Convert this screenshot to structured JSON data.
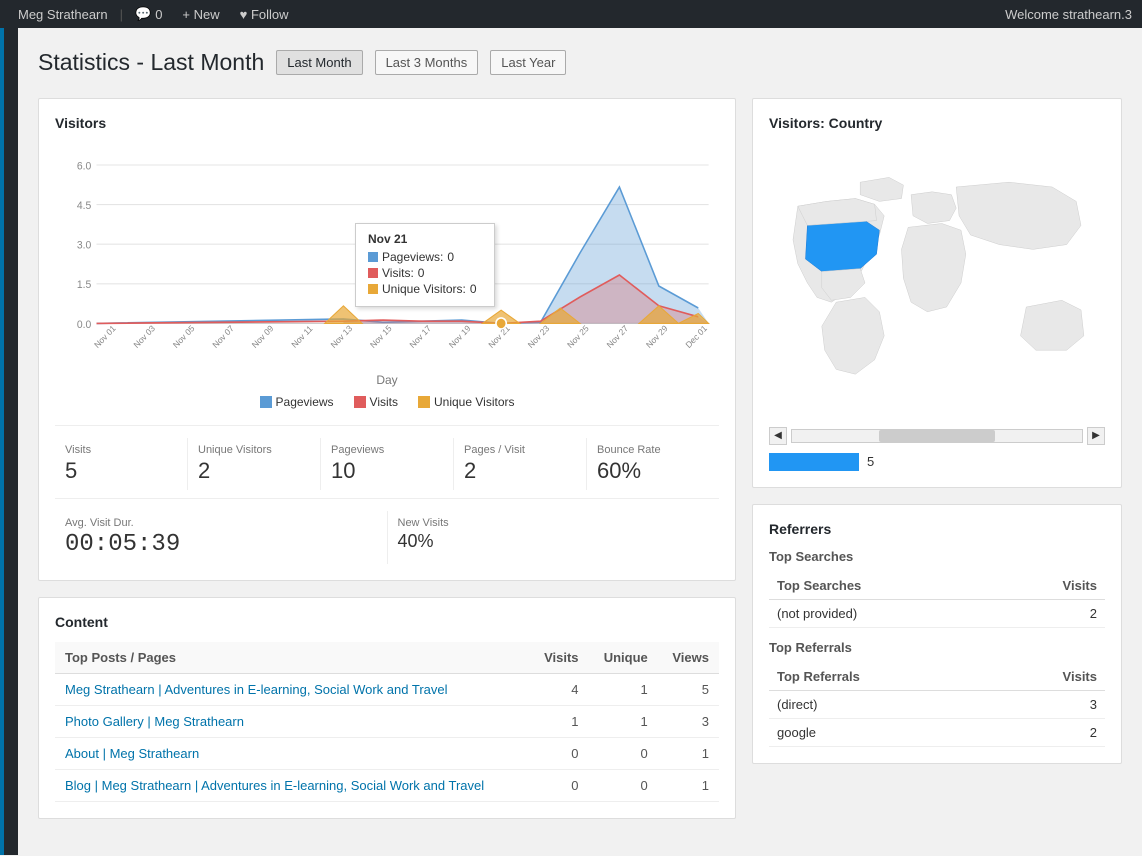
{
  "topbar": {
    "site_name": "Meg Strathearn",
    "comment_icon": "💬",
    "comment_count": "0",
    "new_label": "+ New",
    "follow_label": "♥ Follow",
    "welcome_text": "Welcome strathearn.3"
  },
  "page": {
    "title": "Statistics - Last Month",
    "tabs": [
      {
        "id": "last-month",
        "label": "Last Month",
        "active": true
      },
      {
        "id": "last-3-months",
        "label": "Last 3 Months",
        "active": false
      },
      {
        "id": "last-year",
        "label": "Last Year",
        "active": false
      }
    ]
  },
  "visitors_card": {
    "title": "Visitors",
    "chart": {
      "y_axis": [
        "6.0",
        "4.5",
        "3.0",
        "1.5",
        "0.0"
      ],
      "x_axis": [
        "Nov 01",
        "Nov 03",
        "Nov 05",
        "Nov 07",
        "Nov 09",
        "Nov 11",
        "Nov 13",
        "Nov 15",
        "Nov 17",
        "Nov 19",
        "Nov 21",
        "Nov 23",
        "Nov 25",
        "Nov 27",
        "Nov 29",
        "Dec 01"
      ],
      "axis_label": "Day",
      "tooltip": {
        "date": "Nov 21",
        "pageviews_label": "Pageviews:",
        "pageviews_val": "0",
        "visits_label": "Visits:",
        "visits_val": "0",
        "unique_label": "Unique Visitors:",
        "unique_val": "0"
      },
      "legend": [
        {
          "label": "Pageviews",
          "color": "#5b9bd5"
        },
        {
          "label": "Visits",
          "color": "#e05c5c"
        },
        {
          "label": "Unique Visitors",
          "color": "#e8a838"
        }
      ]
    },
    "stats": [
      {
        "label": "Visits",
        "value": "5"
      },
      {
        "label": "Unique Visitors",
        "value": "2"
      },
      {
        "label": "Pageviews",
        "value": "10"
      },
      {
        "label": "Pages / Visit",
        "value": "2"
      },
      {
        "label": "Bounce Rate",
        "value": "60%"
      }
    ],
    "stats2": [
      {
        "label": "Avg. Visit Dur.",
        "value": "00:05:39",
        "large": true
      },
      {
        "label": "New Visits",
        "value": "40%",
        "large": false
      }
    ]
  },
  "content_card": {
    "title": "Content",
    "table_headers": [
      "Top Posts / Pages",
      "Visits",
      "Unique",
      "Views"
    ],
    "rows": [
      {
        "title": "Meg Strathearn | Adventures in E-learning, Social Work and Travel",
        "visits": "4",
        "unique": "1",
        "views": "5"
      },
      {
        "title": "Photo Gallery | Meg Strathearn",
        "visits": "1",
        "unique": "1",
        "views": "3"
      },
      {
        "title": "About | Meg Strathearn",
        "visits": "0",
        "unique": "0",
        "views": "1"
      },
      {
        "title": "Blog | Meg Strathearn | Adventures in E-learning, Social Work and Travel",
        "visits": "0",
        "unique": "0",
        "views": "1"
      }
    ]
  },
  "visitors_country_card": {
    "title": "Visitors: Country",
    "country_bar_width": 90,
    "country_count": "5"
  },
  "referrers_card": {
    "title": "Referrers",
    "top_searches_title": "Top Searches",
    "top_searches_visits": "Visits",
    "top_searches": [
      {
        "term": "(not provided)",
        "visits": "2"
      }
    ],
    "top_referrals_title": "Top Referrals",
    "top_referrals_visits": "Visits",
    "top_referrals": [
      {
        "term": "(direct)",
        "visits": "3"
      },
      {
        "term": "google",
        "visits": "2"
      }
    ]
  }
}
